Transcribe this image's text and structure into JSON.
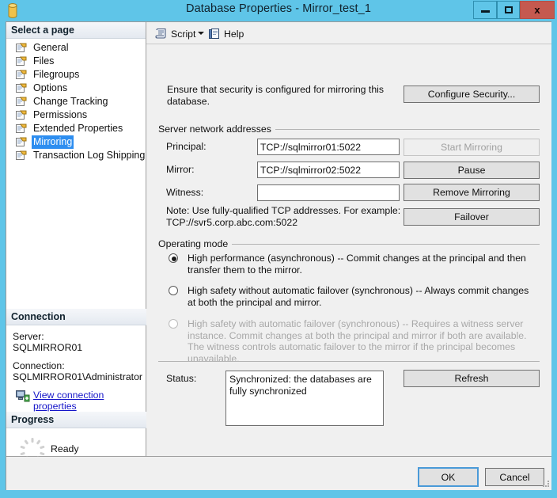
{
  "window": {
    "title": "Database Properties - Mirror_test_1",
    "icon": "database-icon",
    "minimize_label": "",
    "maximize_label": "",
    "close_label": "x"
  },
  "sidebar": {
    "pages_header": "Select a page",
    "pages": [
      {
        "label": "General",
        "selected": false
      },
      {
        "label": "Files",
        "selected": false
      },
      {
        "label": "Filegroups",
        "selected": false
      },
      {
        "label": "Options",
        "selected": false
      },
      {
        "label": "Change Tracking",
        "selected": false
      },
      {
        "label": "Permissions",
        "selected": false
      },
      {
        "label": "Extended Properties",
        "selected": false
      },
      {
        "label": "Mirroring",
        "selected": true
      },
      {
        "label": "Transaction Log Shipping",
        "selected": false
      }
    ],
    "connection_header": "Connection",
    "server_label": "Server:",
    "server_value": "SQLMIRROR01",
    "connection_label": "Connection:",
    "connection_value": "SQLMIRROR01\\Administrator",
    "view_connection_link": "View connection properties",
    "progress_header": "Progress",
    "progress_status": "Ready"
  },
  "toolbar": {
    "script_label": "Script",
    "help_label": "Help"
  },
  "main": {
    "intro_text": "Ensure that security is configured for mirroring this database.",
    "configure_security_label": "Configure Security...",
    "network_group_label": "Server network addresses",
    "principal_label": "Principal:",
    "principal_value": "TCP://sqlmirror01:5022",
    "mirror_label": "Mirror:",
    "mirror_value": "TCP://sqlmirror02:5022",
    "witness_label": "Witness:",
    "witness_value": "",
    "witness_placeholder": "",
    "note_text": "Note: Use fully-qualified TCP addresses. For example: TCP://svr5.corp.abc.com:5022",
    "start_mirroring_label": "Start Mirroring",
    "pause_label": "Pause",
    "remove_mirroring_label": "Remove Mirroring",
    "failover_label": "Failover",
    "operating_mode_label": "Operating mode",
    "modes": [
      {
        "label": "High performance (asynchronous) -- Commit changes at the principal and then transfer them to the mirror.",
        "selected": true,
        "disabled": false
      },
      {
        "label": "High safety without automatic failover (synchronous) -- Always commit changes at both the principal and mirror.",
        "selected": false,
        "disabled": false
      },
      {
        "label": "High safety with automatic failover (synchronous) -- Requires a witness server instance. Commit changes at both the principal and mirror if both are available. The witness controls automatic failover to the mirror if the principal becomes unavailable.",
        "selected": false,
        "disabled": true
      }
    ],
    "status_label": "Status:",
    "status_value": "Synchronized: the databases are fully synchronized",
    "refresh_label": "Refresh"
  },
  "footer": {
    "ok_label": "OK",
    "cancel_label": "Cancel"
  },
  "colors": {
    "titlebar": "#5fc5e8",
    "close_button": "#c5594f",
    "selection": "#2e8ef0",
    "panel_bg": "#f0f0f0",
    "link": "#1414c8",
    "disabled_text": "#a8a8a8"
  }
}
